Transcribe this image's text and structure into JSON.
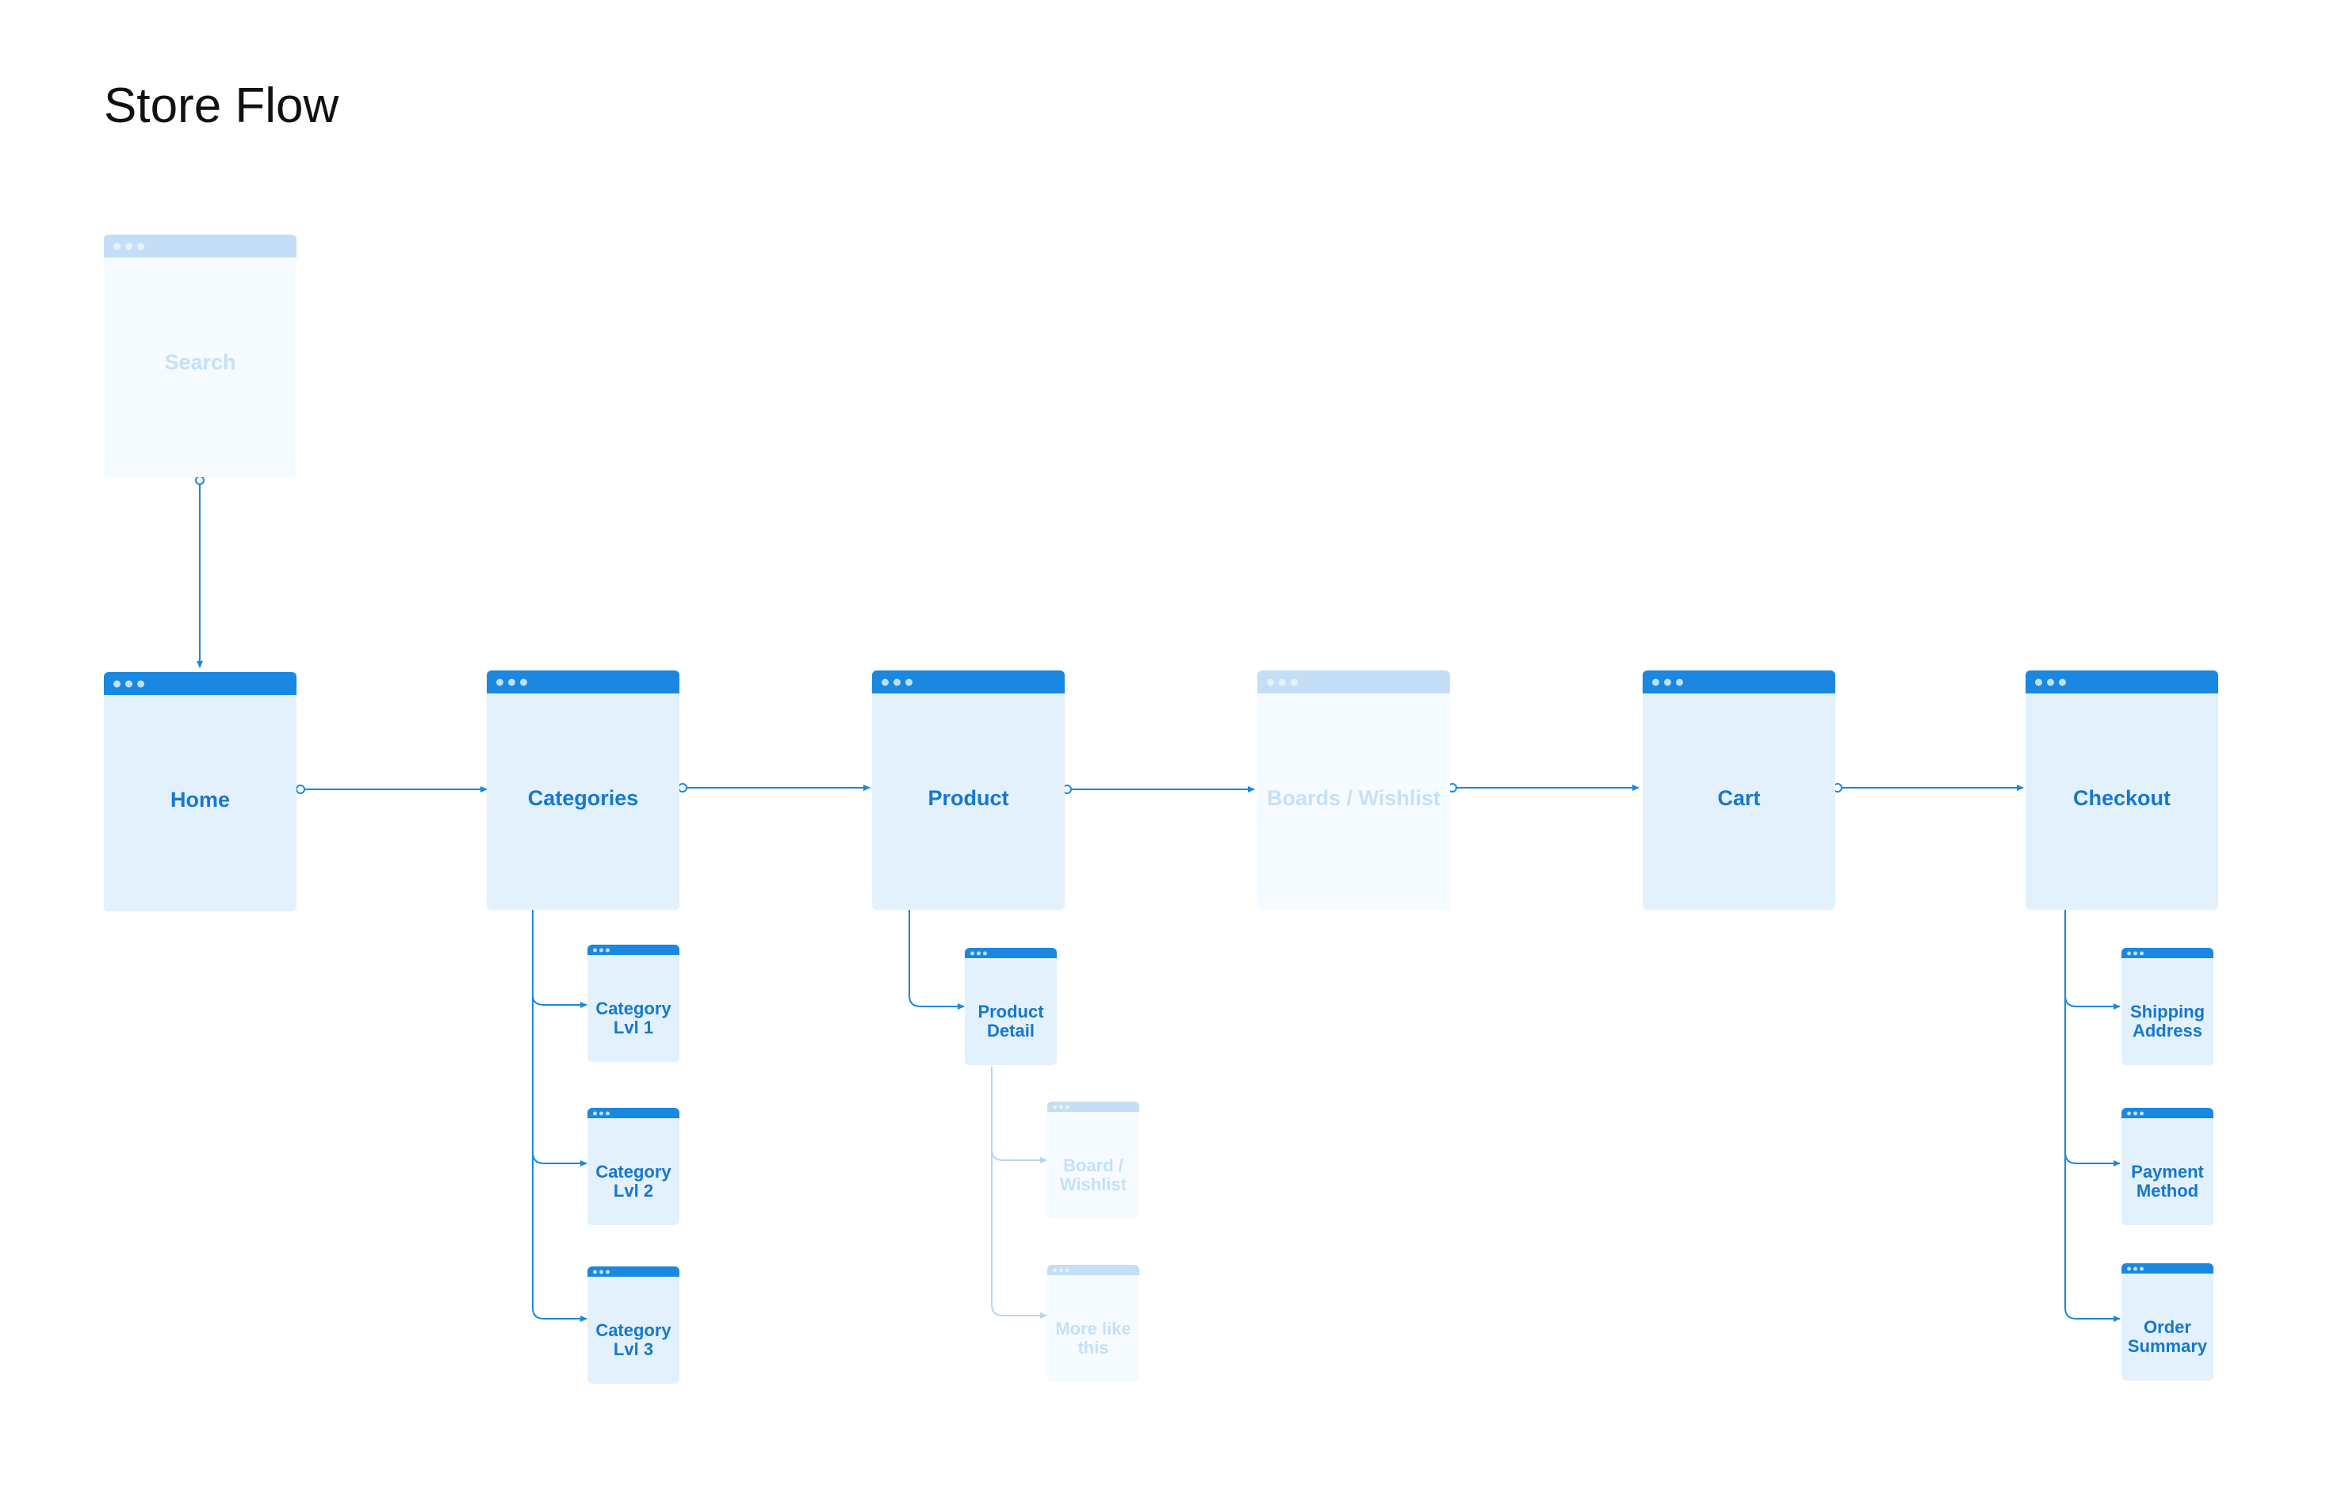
{
  "title": "Store Flow",
  "screens": {
    "search": "Search",
    "home": "Home",
    "categories": "Categories",
    "product": "Product",
    "boards_wishlist": "Boards / Wishlist",
    "cart": "Cart",
    "checkout": "Checkout",
    "category_lvl_1": "Category\nLvl 1",
    "category_lvl_2": "Category\nLvl 2",
    "category_lvl_3": "Category\nLvl 3",
    "product_detail": "Product\nDetail",
    "board_wishlist": "Board /\nWishlist",
    "more_like_this": "More like\nthis",
    "shipping_address": "Shipping\nAddress",
    "payment_method": "Payment\nMethod",
    "order_summary": "Order\nSummary"
  },
  "colors": {
    "accent": "#1a87e0",
    "card_fill": "#e3f1fc",
    "label": "#1677cf",
    "faded_bar": "#c3def6",
    "faded_label": "#c6e0f6"
  }
}
